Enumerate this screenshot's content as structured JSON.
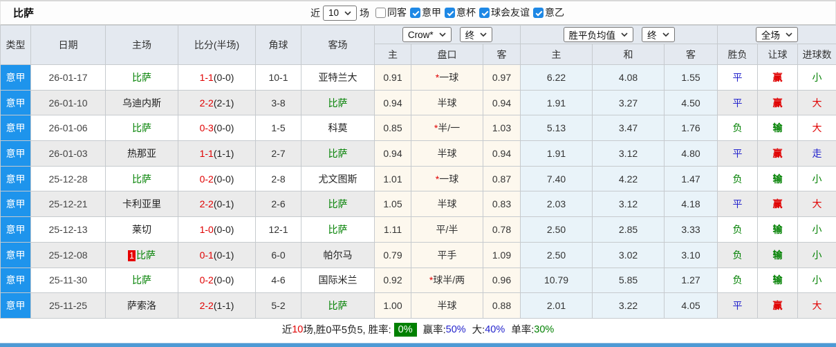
{
  "colors": {
    "league-bg": "#1e94ec",
    "red": "#e00000",
    "green": "#008000",
    "blue": "#2323cc",
    "crow-col": "#fdf8ee",
    "avg-col": "#e9f3f9",
    "row-alt": "#ebebeb",
    "header-bg": "#e4e9f0",
    "accent-bar": "#4d9ad5",
    "winrate-bg": "#008000"
  },
  "header": {
    "title": "比萨",
    "filters": {
      "recent_label": "近",
      "recent_value": "10",
      "matches_label": "场",
      "checkboxes": [
        {
          "label": "同客",
          "checked": false
        },
        {
          "label": "意甲",
          "checked": true
        },
        {
          "label": "意杯",
          "checked": true
        },
        {
          "label": "球会友谊",
          "checked": true
        },
        {
          "label": "意乙",
          "checked": true
        }
      ]
    }
  },
  "table": {
    "left_headers": [
      "类型",
      "日期",
      "主场",
      "比分(半场)",
      "角球",
      "客场"
    ],
    "odds_group": {
      "bookmaker_select": "Crow*",
      "time_select": "终",
      "columns": [
        "主",
        "盘口",
        "客"
      ]
    },
    "avg_group": {
      "select": "胜平负均值",
      "time_select": "终",
      "columns": [
        "主",
        "和",
        "客"
      ]
    },
    "full_group": {
      "select": "全场",
      "columns": [
        "胜负",
        "让球",
        "进球数"
      ]
    },
    "rows": [
      {
        "league": "意甲",
        "date": "26-01-17",
        "home_badge": "",
        "home": "比萨",
        "home_color": "green",
        "score_ft": "1-1",
        "score_ht": "(0-0)",
        "corners": "10-1",
        "away": "亚特兰大",
        "away_color": "black",
        "odds_home": "0.91",
        "handicap_star": "*",
        "handicap": "一球",
        "odds_away": "0.97",
        "avg_home": "6.22",
        "avg_draw": "4.08",
        "avg_away": "1.55",
        "result": "平",
        "result_color": "blue",
        "cover": "赢",
        "cover_color": "red",
        "goals": "小",
        "goals_color": "green"
      },
      {
        "league": "意甲",
        "date": "26-01-10",
        "home_badge": "",
        "home": "乌迪内斯",
        "home_color": "black",
        "score_ft": "2-2",
        "score_ht": "(2-1)",
        "corners": "3-8",
        "away": "比萨",
        "away_color": "green",
        "odds_home": "0.94",
        "handicap_star": "",
        "handicap": "半球",
        "odds_away": "0.94",
        "avg_home": "1.91",
        "avg_draw": "3.27",
        "avg_away": "4.50",
        "result": "平",
        "result_color": "blue",
        "cover": "赢",
        "cover_color": "red",
        "goals": "大",
        "goals_color": "red"
      },
      {
        "league": "意甲",
        "date": "26-01-06",
        "home_badge": "",
        "home": "比萨",
        "home_color": "green",
        "score_ft": "0-3",
        "score_ht": "(0-0)",
        "corners": "1-5",
        "away": "科莫",
        "away_color": "black",
        "odds_home": "0.85",
        "handicap_star": "*",
        "handicap": "半/一",
        "odds_away": "1.03",
        "avg_home": "5.13",
        "avg_draw": "3.47",
        "avg_away": "1.76",
        "result": "负",
        "result_color": "green",
        "cover": "输",
        "cover_color": "green",
        "goals": "大",
        "goals_color": "red"
      },
      {
        "league": "意甲",
        "date": "26-01-03",
        "home_badge": "",
        "home": "热那亚",
        "home_color": "black",
        "score_ft": "1-1",
        "score_ht": "(1-1)",
        "corners": "2-7",
        "away": "比萨",
        "away_color": "green",
        "odds_home": "0.94",
        "handicap_star": "",
        "handicap": "半球",
        "odds_away": "0.94",
        "avg_home": "1.91",
        "avg_draw": "3.12",
        "avg_away": "4.80",
        "result": "平",
        "result_color": "blue",
        "cover": "赢",
        "cover_color": "red",
        "goals": "走",
        "goals_color": "blue"
      },
      {
        "league": "意甲",
        "date": "25-12-28",
        "home_badge": "",
        "home": "比萨",
        "home_color": "green",
        "score_ft": "0-2",
        "score_ht": "(0-0)",
        "corners": "2-8",
        "away": "尤文图斯",
        "away_color": "black",
        "odds_home": "1.01",
        "handicap_star": "*",
        "handicap": "一球",
        "odds_away": "0.87",
        "avg_home": "7.40",
        "avg_draw": "4.22",
        "avg_away": "1.47",
        "result": "负",
        "result_color": "green",
        "cover": "输",
        "cover_color": "green",
        "goals": "小",
        "goals_color": "green"
      },
      {
        "league": "意甲",
        "date": "25-12-21",
        "home_badge": "",
        "home": "卡利亚里",
        "home_color": "black",
        "score_ft": "2-2",
        "score_ht": "(0-1)",
        "corners": "2-6",
        "away": "比萨",
        "away_color": "green",
        "odds_home": "1.05",
        "handicap_star": "",
        "handicap": "半球",
        "odds_away": "0.83",
        "avg_home": "2.03",
        "avg_draw": "3.12",
        "avg_away": "4.18",
        "result": "平",
        "result_color": "blue",
        "cover": "赢",
        "cover_color": "red",
        "goals": "大",
        "goals_color": "red"
      },
      {
        "league": "意甲",
        "date": "25-12-13",
        "home_badge": "",
        "home": "莱切",
        "home_color": "black",
        "score_ft": "1-0",
        "score_ht": "(0-0)",
        "corners": "12-1",
        "away": "比萨",
        "away_color": "green",
        "odds_home": "1.11",
        "handicap_star": "",
        "handicap": "平/半",
        "odds_away": "0.78",
        "avg_home": "2.50",
        "avg_draw": "2.85",
        "avg_away": "3.33",
        "result": "负",
        "result_color": "green",
        "cover": "输",
        "cover_color": "green",
        "goals": "小",
        "goals_color": "green"
      },
      {
        "league": "意甲",
        "date": "25-12-08",
        "home_badge": "1",
        "home": "比萨",
        "home_color": "green",
        "score_ft": "0-1",
        "score_ht": "(0-1)",
        "corners": "6-0",
        "away": "帕尔马",
        "away_color": "black",
        "odds_home": "0.79",
        "handicap_star": "",
        "handicap": "平手",
        "odds_away": "1.09",
        "avg_home": "2.50",
        "avg_draw": "3.02",
        "avg_away": "3.10",
        "result": "负",
        "result_color": "green",
        "cover": "输",
        "cover_color": "green",
        "goals": "小",
        "goals_color": "green"
      },
      {
        "league": "意甲",
        "date": "25-11-30",
        "home_badge": "",
        "home": "比萨",
        "home_color": "green",
        "score_ft": "0-2",
        "score_ht": "(0-0)",
        "corners": "4-6",
        "away": "国际米兰",
        "away_color": "black",
        "odds_home": "0.92",
        "handicap_star": "*",
        "handicap": "球半/两",
        "odds_away": "0.96",
        "avg_home": "10.79",
        "avg_draw": "5.85",
        "avg_away": "1.27",
        "result": "负",
        "result_color": "green",
        "cover": "输",
        "cover_color": "green",
        "goals": "小",
        "goals_color": "green"
      },
      {
        "league": "意甲",
        "date": "25-11-25",
        "home_badge": "",
        "home": "萨索洛",
        "home_color": "black",
        "score_ft": "2-2",
        "score_ht": "(1-1)",
        "corners": "5-2",
        "away": "比萨",
        "away_color": "green",
        "odds_home": "1.00",
        "handicap_star": "",
        "handicap": "半球",
        "odds_away": "0.88",
        "avg_home": "2.01",
        "avg_draw": "3.22",
        "avg_away": "4.05",
        "result": "平",
        "result_color": "blue",
        "cover": "赢",
        "cover_color": "red",
        "goals": "大",
        "goals_color": "red"
      }
    ]
  },
  "summary": {
    "recent_label": "近",
    "recent_count": "10",
    "record_text": "场,胜0平5负5, 胜率:",
    "win_rate": "0%",
    "cover_label": "赢率:",
    "cover_rate": "50%",
    "big_label": "大:",
    "big_rate": "40%",
    "single_label": "单率:",
    "single_rate": "30%"
  }
}
